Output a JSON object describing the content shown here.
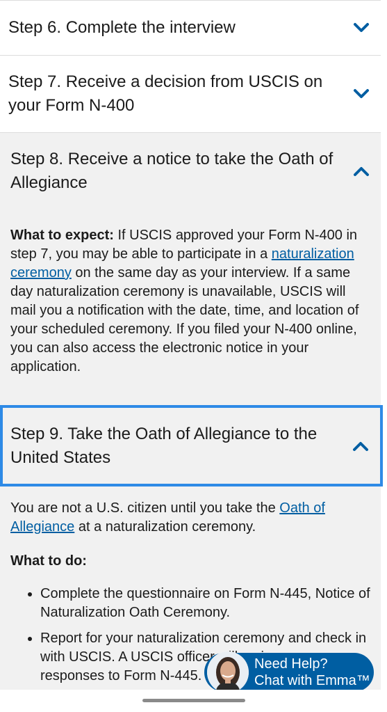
{
  "steps": {
    "step6": {
      "title": "Step 6. Complete the interview",
      "state": "collapsed"
    },
    "step7": {
      "title": "Step 7. Receive a decision from USCIS on your Form N-400",
      "state": "collapsed"
    },
    "step8": {
      "title": "Step 8. Receive a notice to take the Oath of Allegiance",
      "state": "expanded",
      "body": {
        "lead": "What to expect:",
        "text1": " If USCIS approved your Form N-400 in step 7, you may be able to participate in a ",
        "link": "naturalization ceremony",
        "text2": " on the same day as your interview. If a same day naturalization ceremony is unavailable, USCIS will mail you a notification with the date, time, and location of your scheduled ceremony. If you filed your N-400 online, you can also access the electronic notice in your application."
      }
    },
    "step9": {
      "title": "Step 9. Take the Oath of Allegiance to the United States",
      "state": "expanded",
      "body": {
        "intro1": "You are not a U.S. citizen until you take the ",
        "intro_link": "Oath of Allegiance",
        "intro2": " at a naturalization ceremony.",
        "todo_heading": "What to do:",
        "items": [
          "Complete the questionnaire on Form N-445, Notice of Naturalization Oath Ceremony.",
          "Report for your naturalization ceremony and check in with USCIS. A USCIS officer will review your responses to Form N-445."
        ]
      }
    }
  },
  "chat_widget": {
    "line1": "Need Help?",
    "line2": "Chat with Emma™"
  },
  "colors": {
    "link": "#005ea2",
    "chevron": "#005ea2",
    "focus_border": "#2e8ae6",
    "panel_bg": "#f1f1f1"
  }
}
